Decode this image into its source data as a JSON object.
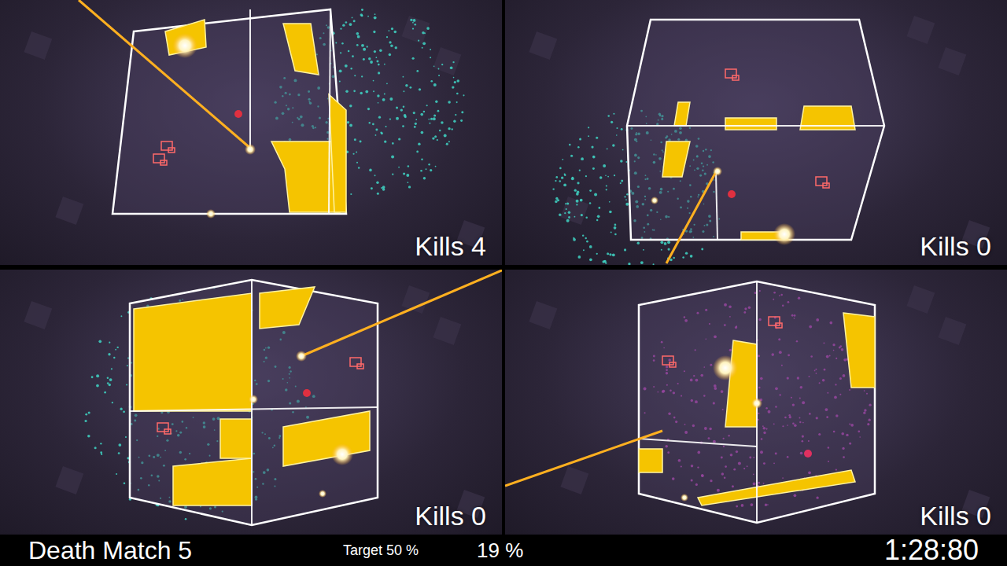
{
  "viewports": [
    {
      "kills": "Kills 4",
      "color": "#3fd6c6"
    },
    {
      "kills": "Kills 0",
      "color": "#3fd6c6"
    },
    {
      "kills": "Kills 0",
      "color": "#3fd6c6"
    },
    {
      "kills": "Kills 0",
      "color": "#d64fd6"
    }
  ],
  "status_bar": {
    "mode": "Death Match 5",
    "target": "Target 50 %",
    "progress": "19 %",
    "timer": "1:28:80"
  }
}
